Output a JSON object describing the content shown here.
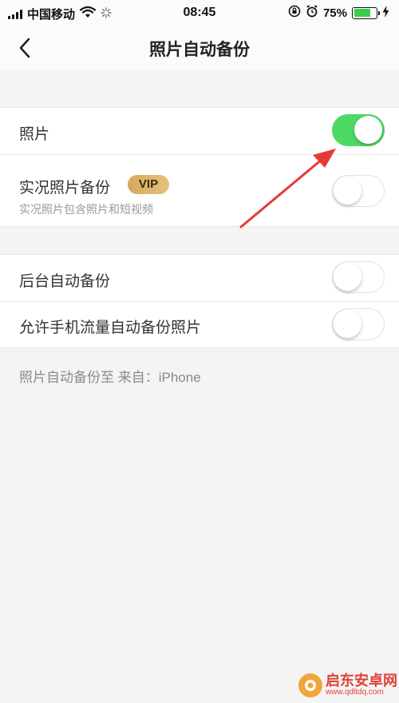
{
  "status_bar": {
    "carrier": "中国移动",
    "time": "08:45",
    "battery_percent": "75%",
    "battery_level": 0.75,
    "icons": [
      "signal-icon",
      "wifi-icon",
      "loading-icon",
      "rotation-lock-icon",
      "alarm-icon",
      "battery-icon",
      "charging-icon"
    ]
  },
  "navbar": {
    "title": "照片自动备份",
    "back_icon": "chevron-left-icon"
  },
  "settings": {
    "photos": {
      "label": "照片",
      "enabled": true
    },
    "live_photos": {
      "label": "实况照片备份",
      "badge": "VIP",
      "subtitle": "实况照片包含照片和短视频",
      "enabled": false
    },
    "background_backup": {
      "label": "后台自动备份",
      "enabled": false
    },
    "cellular_backup": {
      "label": "允许手机流量自动备份照片",
      "enabled": false
    }
  },
  "footer_note": "照片自动备份至 来自：iPhone",
  "colors": {
    "toggle_on": "#4cd964",
    "vip_badge": "#e0b567",
    "annotation_arrow": "#e53935"
  },
  "watermark": {
    "text": "启东安卓网",
    "url": "www.qdltdq.com"
  }
}
